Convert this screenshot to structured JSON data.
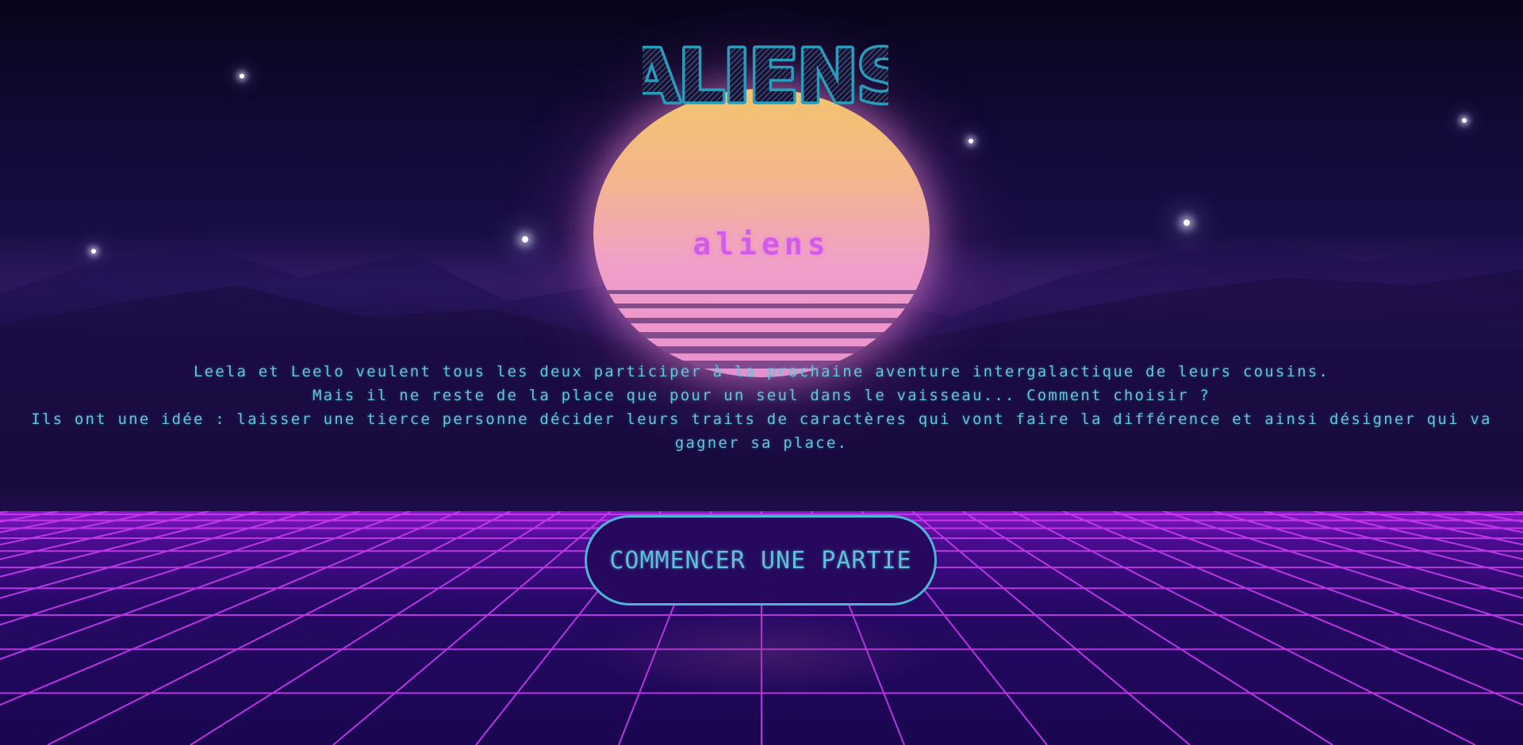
{
  "page": {
    "logo_text": "ALIENS",
    "subtitle": "aliens",
    "intro_lines": [
      "Leela et Leelo veulent tous les deux participer à la prochaine aventure intergalactique de leurs cousins.",
      "Mais il ne reste de la place que pour un seul dans le vaisseau... Comment choisir ?",
      "Ils ont une idée : laisser une tierce personne décider leurs traits de caractères qui vont faire la différence et ainsi désigner qui va gagner sa place."
    ],
    "start_button_label": "COMMENCER UNE PARTIE"
  },
  "colors": {
    "logo_stroke": "#2a9bb8",
    "subtitle": "#d05ce8",
    "intro_text": "#5fc7d9",
    "button_border": "#4fb3d6",
    "button_bg": "#26095e",
    "grid_line": "#c93cf0"
  }
}
